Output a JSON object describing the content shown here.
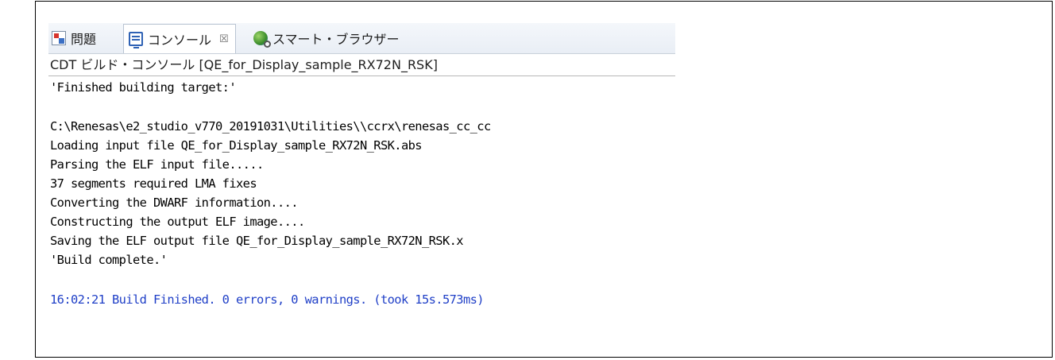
{
  "tabs": [
    {
      "label": "問題",
      "icon": "problems-icon"
    },
    {
      "label": "コンソール",
      "icon": "console-icon",
      "close": "☒"
    },
    {
      "label": "スマート・ブラウザー",
      "icon": "smart-browser-icon"
    }
  ],
  "console": {
    "title": "CDT ビルド・コンソール [QE_for_Display_sample_RX72N_RSK]",
    "lines": [
      "'Finished building target:'",
      "",
      "C:\\Renesas\\e2_studio_v770_20191031\\Utilities\\\\ccrx\\renesas_cc_cc",
      "Loading input file QE_for_Display_sample_RX72N_RSK.abs",
      "Parsing the ELF input file.....",
      "37 segments required LMA fixes",
      "Converting the DWARF information....",
      "Constructing the output ELF image....",
      "Saving the ELF output file QE_for_Display_sample_RX72N_RSK.x",
      "'Build complete.'",
      "",
      "16:02:21 Build Finished. 0 errors, 0 warnings. (took 15s.573ms)"
    ],
    "status_color": "#1f3fc7"
  }
}
